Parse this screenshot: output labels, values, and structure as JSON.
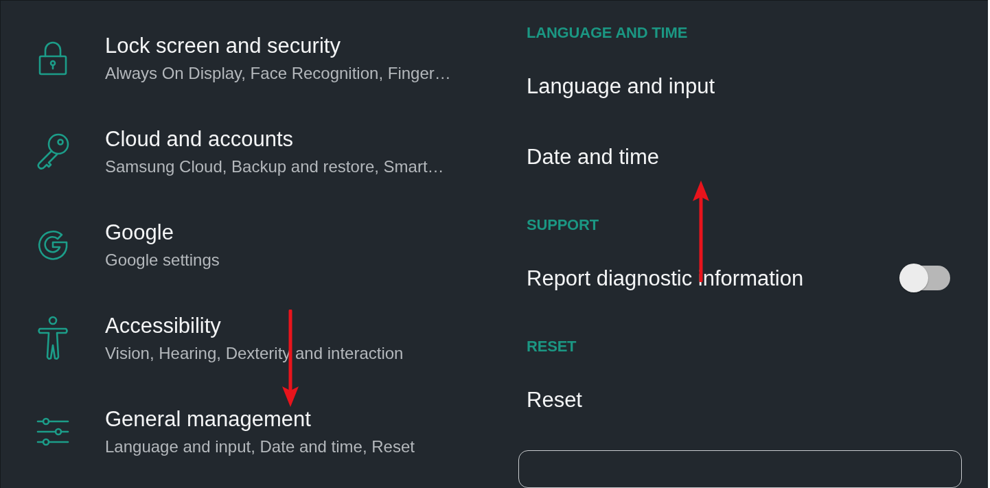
{
  "left_menu": {
    "items": [
      {
        "title": "Lock screen and security",
        "subtitle": "Always On Display, Face Recognition, Finger…"
      },
      {
        "title": "Cloud and accounts",
        "subtitle": "Samsung Cloud, Backup and restore, Smart…"
      },
      {
        "title": "Google",
        "subtitle": "Google settings"
      },
      {
        "title": "Accessibility",
        "subtitle": "Vision, Hearing, Dexterity and interaction"
      },
      {
        "title": "General management",
        "subtitle": "Language and input, Date and time, Reset"
      }
    ]
  },
  "right_panel": {
    "sections": [
      {
        "header": "LANGUAGE AND TIME",
        "items": [
          {
            "kind": "link",
            "title": "Language and input"
          },
          {
            "kind": "link",
            "title": "Date and time"
          }
        ]
      },
      {
        "header": "SUPPORT",
        "items": [
          {
            "kind": "switch",
            "title": "Report diagnostic information",
            "on": false
          }
        ]
      },
      {
        "header": "RESET",
        "items": [
          {
            "kind": "link",
            "title": "Reset"
          }
        ]
      }
    ]
  }
}
